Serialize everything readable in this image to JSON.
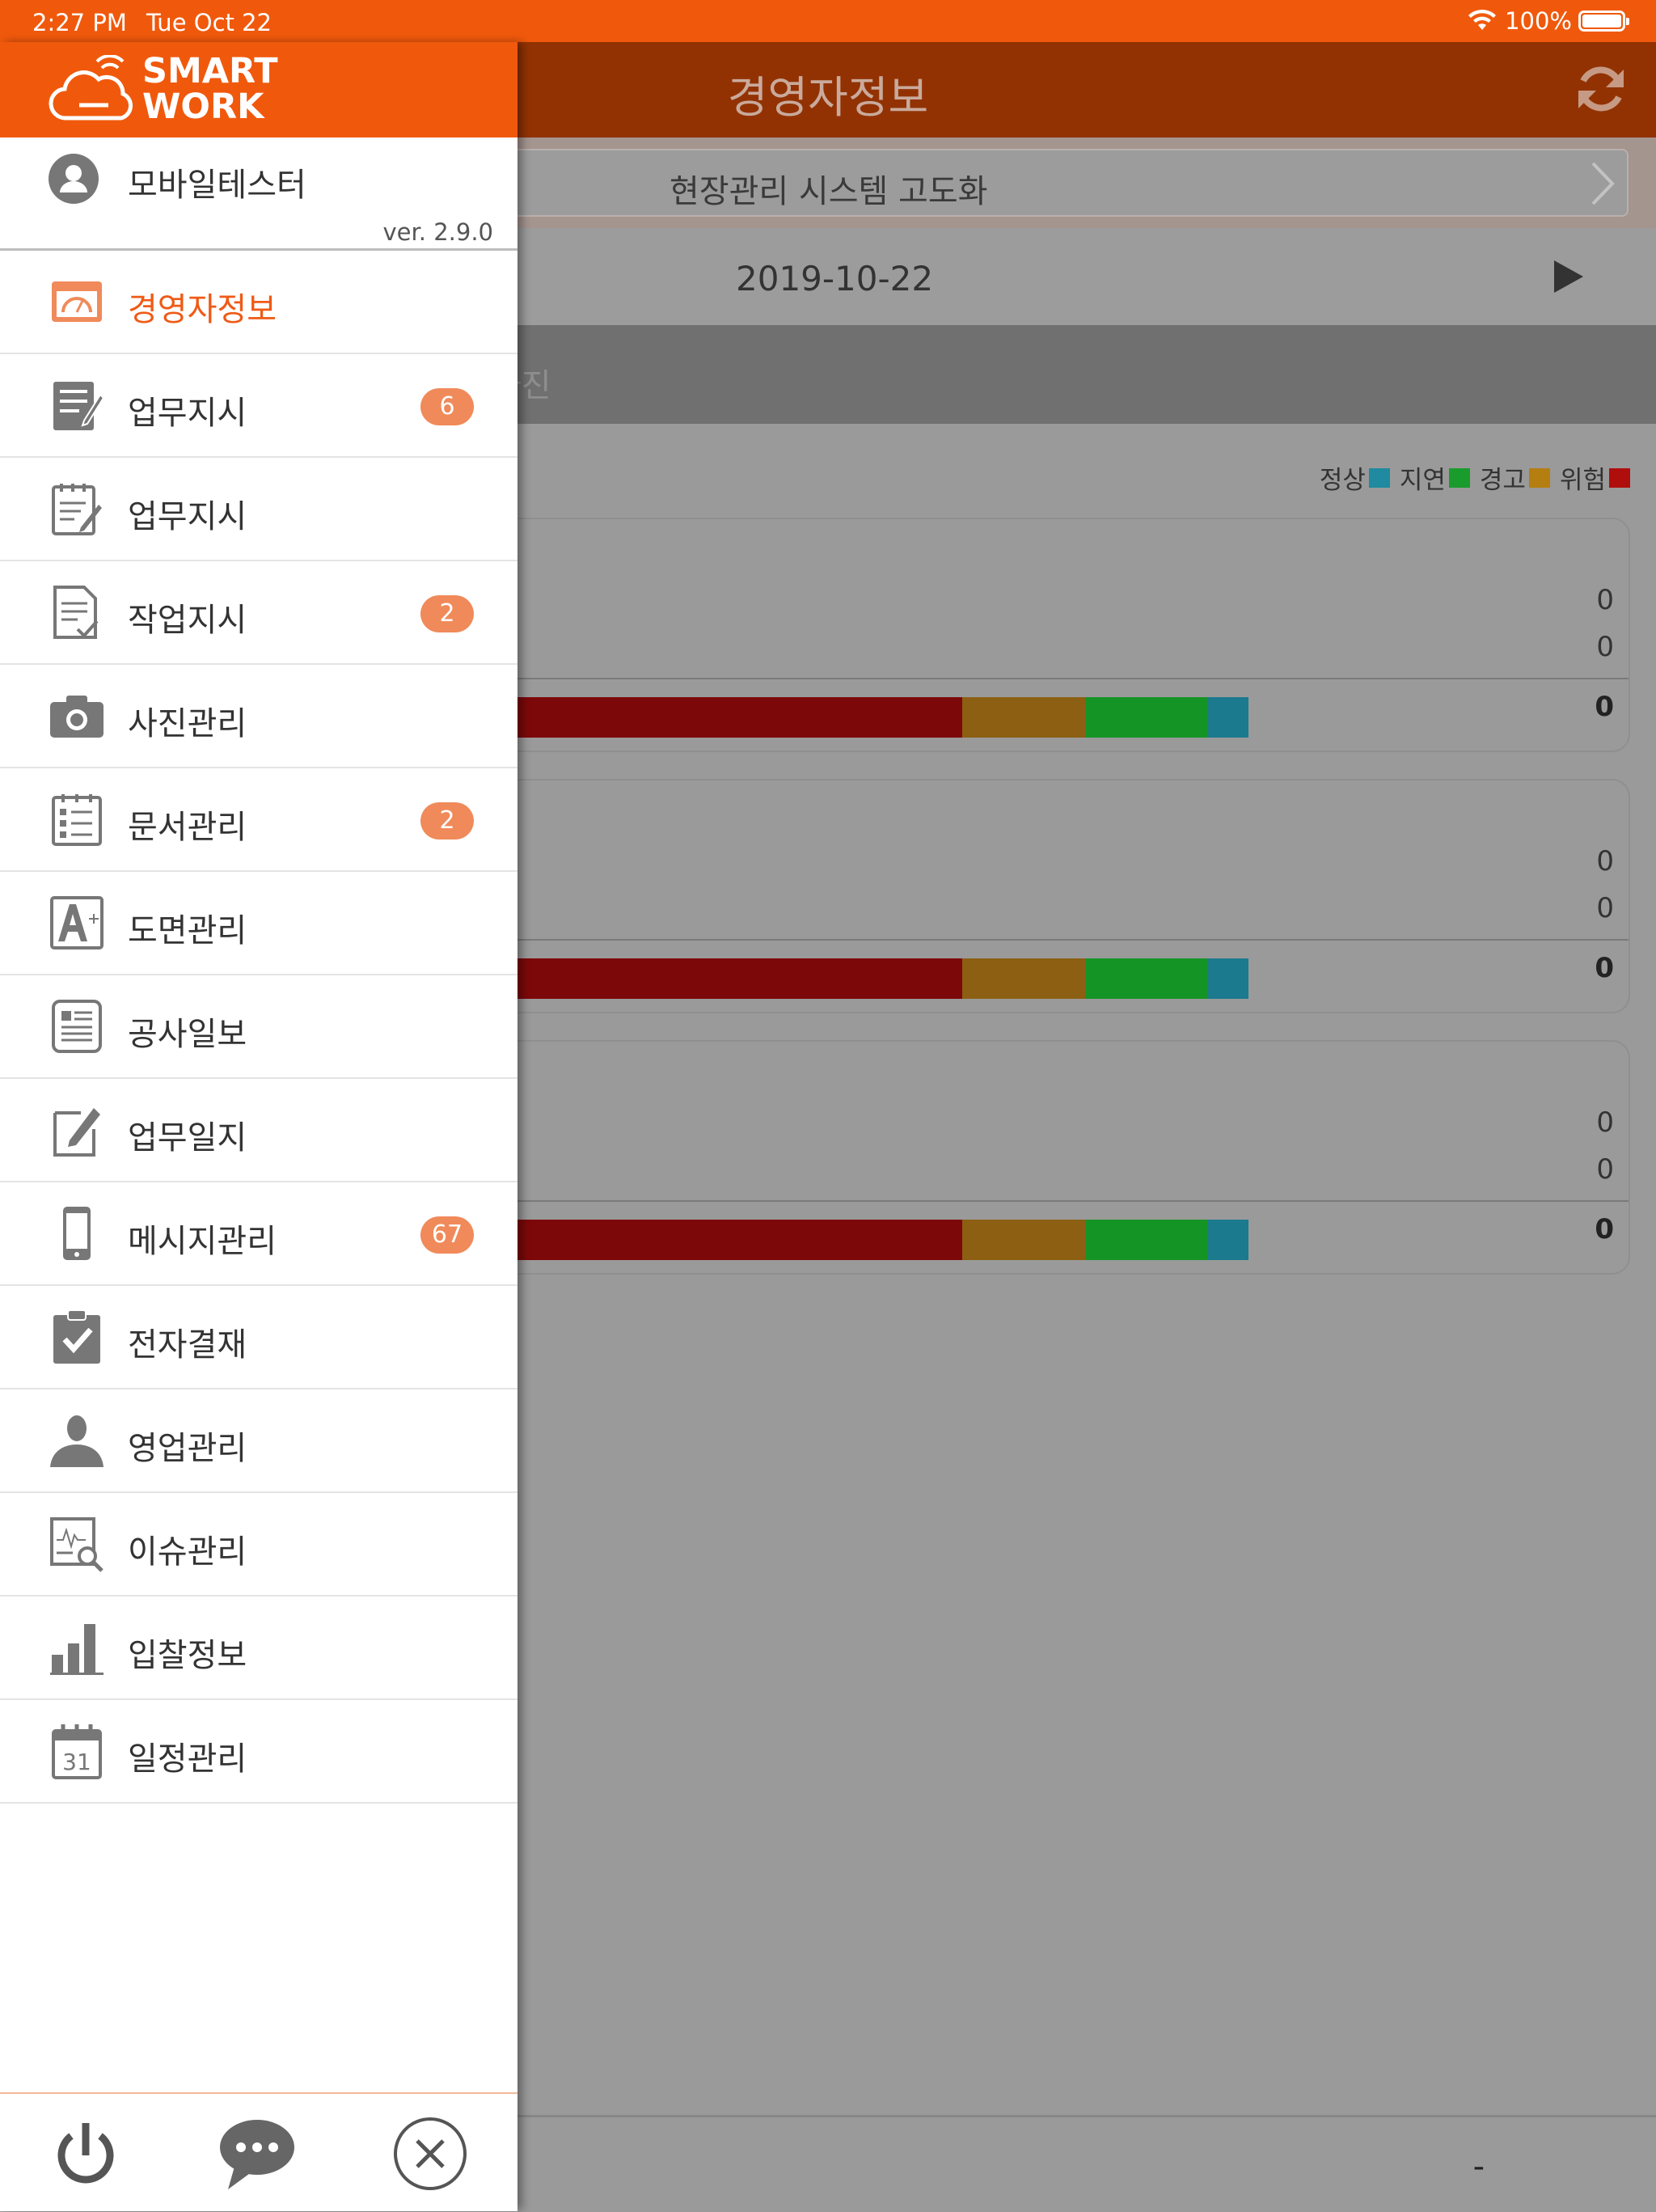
{
  "status_bar": {
    "time": "2:27 PM",
    "date": "Tue Oct 22",
    "battery": "100%"
  },
  "main": {
    "title": "경영자정보",
    "project": "현장관리 시스템 고도화",
    "date": "2019-10-22",
    "tab_partial": "사진",
    "legend": [
      {
        "label": "정상",
        "color": "#1f8aa0"
      },
      {
        "label": "지연",
        "color": "#1a9c2c"
      },
      {
        "label": "경고",
        "color": "#b57e10"
      },
      {
        "label": "위험",
        "color": "#b00d0d"
      }
    ],
    "cards": [
      {
        "v1": "0",
        "v2": "0",
        "total": "0"
      },
      {
        "v1": "0",
        "v2": "0",
        "total": "0"
      },
      {
        "v1": "0",
        "v2": "0",
        "total": "0"
      }
    ],
    "footer_value": "-"
  },
  "drawer": {
    "logo": {
      "line1": "SMART",
      "line2": "WORK"
    },
    "user": {
      "name": "모바일테스터",
      "version": "ver. 2.9.0"
    },
    "menu": [
      {
        "label": "경영자정보",
        "icon": "dashboard-icon",
        "active": true
      },
      {
        "label": "업무지시",
        "icon": "task-edit-icon",
        "badge": "6"
      },
      {
        "label": "업무지시",
        "icon": "notepad-edit-icon"
      },
      {
        "label": "작업지시",
        "icon": "document-check-icon",
        "badge": "2"
      },
      {
        "label": "사진관리",
        "icon": "camera-icon"
      },
      {
        "label": "문서관리",
        "icon": "checklist-icon",
        "badge": "2"
      },
      {
        "label": "도면관리",
        "icon": "drawing-icon"
      },
      {
        "label": "공사일보",
        "icon": "report-icon"
      },
      {
        "label": "업무일지",
        "icon": "journal-edit-icon"
      },
      {
        "label": "메시지관리",
        "icon": "phone-icon",
        "badge": "67"
      },
      {
        "label": "전자결재",
        "icon": "clipboard-check-icon"
      },
      {
        "label": "영업관리",
        "icon": "person-icon"
      },
      {
        "label": "이슈관리",
        "icon": "issue-search-icon"
      },
      {
        "label": "입찰정보",
        "icon": "bar-chart-icon"
      },
      {
        "label": "일정관리",
        "icon": "calendar-icon",
        "day": "31"
      }
    ]
  }
}
